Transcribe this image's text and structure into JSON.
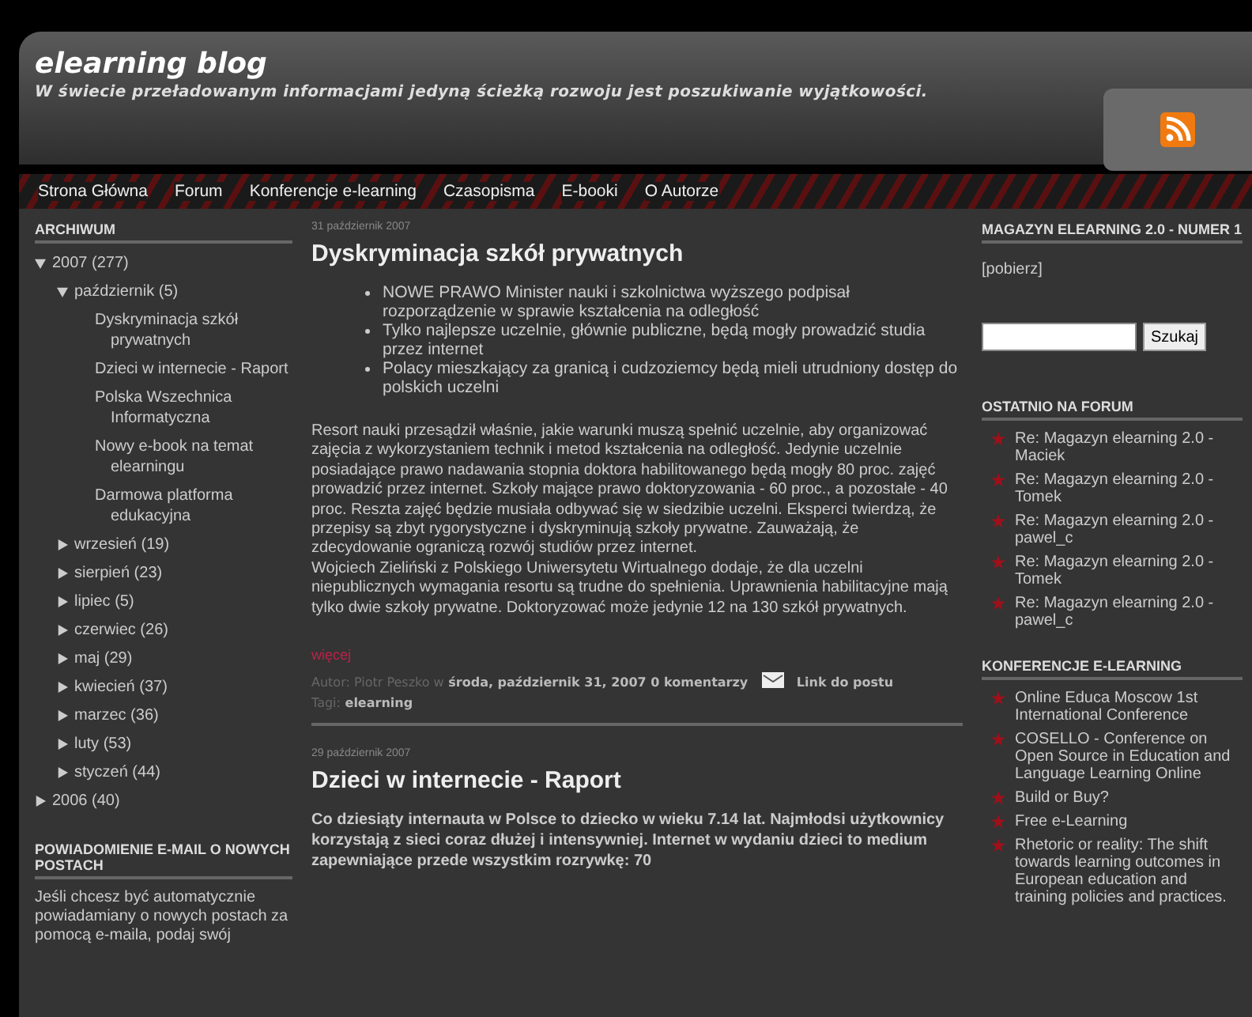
{
  "header": {
    "title": "elearning blog",
    "tagline": "W świecie przeładowanym informacjami jedyną ścieżką rozwoju jest poszukiwanie wyjątkowości."
  },
  "nav": [
    "Strona Główna",
    "Forum",
    "Konferencje e-learning",
    "Czasopisma",
    "E-booki",
    "O Autorze"
  ],
  "archive": {
    "heading": "ARCHIWUM",
    "items": [
      {
        "label": "2007 (277)",
        "expanded": true,
        "children": [
          {
            "label": "październik (5)",
            "expanded": true,
            "children": [
              {
                "label": "Dyskryminacja szkół prywatnych"
              },
              {
                "label": "Dzieci w internecie - Raport"
              },
              {
                "label": "Polska Wszechnica Informatyczna"
              },
              {
                "label": "Nowy e-book na temat elearningu"
              },
              {
                "label": "Darmowa platforma edukacyjna"
              }
            ]
          },
          {
            "label": "wrzesień (19)",
            "expanded": false
          },
          {
            "label": "sierpień (23)",
            "expanded": false
          },
          {
            "label": "lipiec (5)",
            "expanded": false
          },
          {
            "label": "czerwiec (26)",
            "expanded": false
          },
          {
            "label": "maj (29)",
            "expanded": false
          },
          {
            "label": "kwiecień (37)",
            "expanded": false
          },
          {
            "label": "marzec (36)",
            "expanded": false
          },
          {
            "label": "luty (53)",
            "expanded": false
          },
          {
            "label": "styczeń (44)",
            "expanded": false
          }
        ]
      },
      {
        "label": "2006 (40)",
        "expanded": false
      }
    ]
  },
  "email_widget": {
    "heading": "POWIADOMIENIE E-MAIL O NOWYCH POSTACH",
    "text": "Jeśli chcesz być automatycznie powiadamiany o nowych postach za pomocą e-maila, podaj swój"
  },
  "posts": [
    {
      "date": "31 październik 2007",
      "title": "Dyskryminacja szkół prywatnych",
      "bullets": [
        "NOWE PRAWO Minister nauki i szkolnictwa wyższego podpisał rozporządzenie w sprawie kształcenia na odległość",
        "Tylko najlepsze uczelnie, głównie publiczne, będą mogły prowadzić studia przez internet",
        "Polacy mieszkający za granicą i cudzoziemcy będą mieli utrudniony dostęp do polskich uczelni"
      ],
      "paragraphs": [
        "Resort nauki przesądził właśnie, jakie warunki muszą spełnić uczelnie, aby organizować zajęcia z wykorzystaniem technik i metod kształcenia na odległość. Jedynie uczelnie posiadające prawo nadawania stopnia doktora habilitowanego będą mogły 80 proc. zajęć prowadzić przez internet. Szkoły mające prawo doktoryzowania - 60 proc., a pozostałe - 40 proc. Reszta zajęć będzie musiała odbywać się w siedzibie uczelni. Eksperci twierdzą, że przepisy są zbyt rygorystyczne i dyskryminują szkoły prywatne. Zauważają, że zdecydowanie ograniczą rozwój studiów przez internet.",
        "Wojciech Zieliński z Polskiego Uniwersytetu Wirtualnego dodaje, że dla uczelni niepublicznych wymagania resortu są trudne do spełnienia. Uprawnienia habilitacyjne mają tylko dwie szkoły prywatne. Doktoryzować może jedynie 12 na 130 szkół prywatnych."
      ],
      "more": "więcej",
      "author_label": "Autor: Piotr Peszko w",
      "post_date": "środa, październik 31, 2007",
      "comments": "0 komentarzy",
      "link": "Link do postu",
      "tags_label": "Tagi:",
      "tag": "elearning"
    },
    {
      "date": "29 październik 2007",
      "title": "Dzieci w internecie - Raport",
      "lead": "Co dziesiąty internauta w Polsce to dziecko w wieku 7.14 lat. Najmłodsi użytkownicy korzystają z sieci coraz dłużej i intensywniej. Internet w wydaniu dzieci to medium zapewniające przede wszystkim rozrywkę: 70"
    }
  ],
  "magazine": {
    "heading": "MAGAZYN ELEARNING 2.0 - NUMER 1",
    "link": "[pobierz]"
  },
  "search": {
    "button": "Szukaj"
  },
  "forum": {
    "heading": "OSTATNIO NA FORUM",
    "items": [
      "Re: Magazyn elearning 2.0 - Maciek",
      "Re: Magazyn elearning 2.0 - Tomek",
      "Re: Magazyn elearning 2.0 - pawel_c",
      "Re: Magazyn elearning 2.0 - Tomek",
      "Re: Magazyn elearning 2.0 - pawel_c"
    ]
  },
  "conferences": {
    "heading": "KONFERENCJE E-LEARNING",
    "items": [
      "Online Educa Moscow 1st International Conference",
      "COSELLO - Conference on Open Source in Education and Language Learning Online",
      "Build or Buy?",
      "Free e-Learning",
      "Rhetoric or reality: The shift towards learning outcomes in European education and training policies and practices."
    ]
  }
}
